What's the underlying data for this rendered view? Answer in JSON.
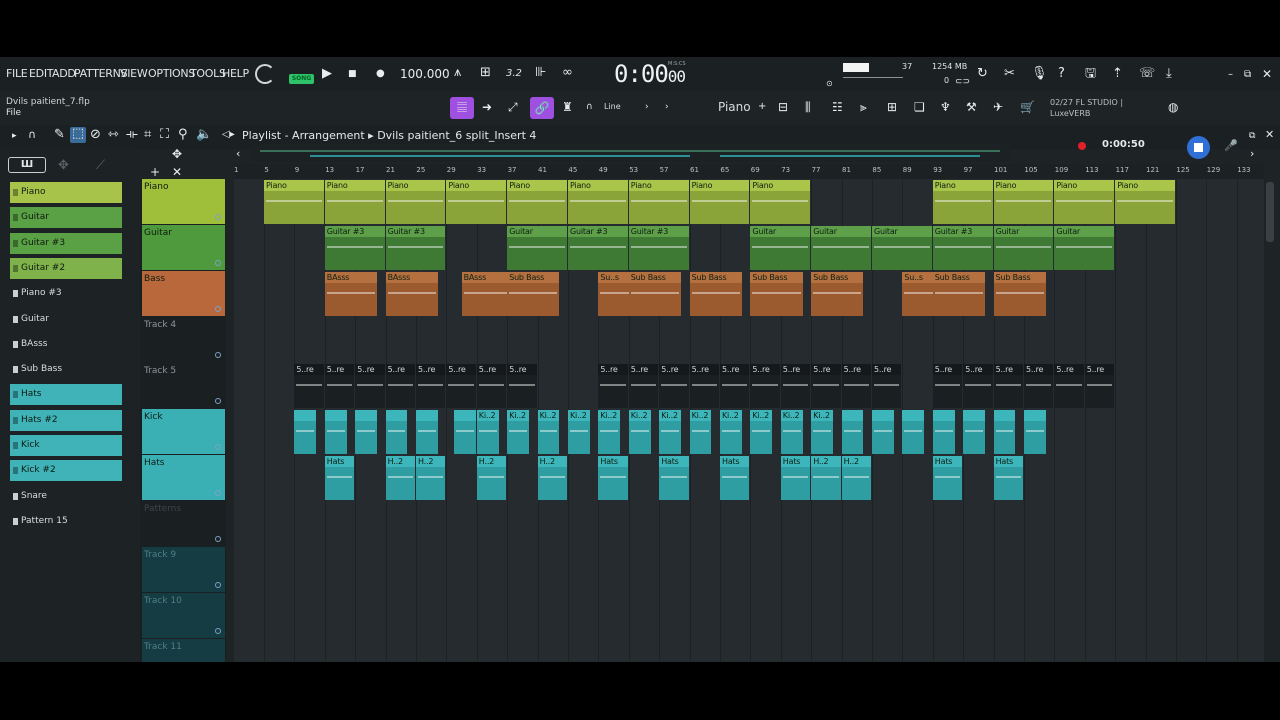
{
  "menu": [
    "FILE",
    "EDIT",
    "ADD",
    "PATTERNS",
    "VIEW",
    "OPTIONS",
    "TOOLS",
    "HELP"
  ],
  "song_mode": "SONG",
  "tempo": "100.000",
  "time_sig": "3.2",
  "clock": "0:00",
  "clock_small": "00",
  "clock_label": "M:S:CS",
  "cpu": "37",
  "memory": "1254 MB",
  "poly": "0",
  "project_file": "Dvils paitient_7.flp",
  "hint": "File",
  "tool_line_label": "Line",
  "piano_label": "Piano",
  "fl_info": {
    "line1": "02/27  FL STUDIO |",
    "line2": "LuxeVERB"
  },
  "playlist_title": "Playlist - Arrangement",
  "playlist_path": "Dvils paitient_6 split_Insert 4",
  "timer": "0:00:50",
  "browser": {
    "toolbar_label": "Ш",
    "patterns": [
      {
        "label": "Piano",
        "color": "#a8c34a"
      },
      {
        "label": "Guitar",
        "color": "#5aa045"
      },
      {
        "label": "Guitar #3",
        "color": "#5aa045"
      },
      {
        "label": "Guitar #2",
        "color": "#7fb24a"
      },
      {
        "label": "Piano #3",
        "color": ""
      },
      {
        "label": "Guitar",
        "color": ""
      },
      {
        "label": "BAsss",
        "color": ""
      },
      {
        "label": "Sub Bass",
        "color": ""
      },
      {
        "label": "Hats",
        "color": "#3fb3b8"
      },
      {
        "label": "Hats #2",
        "color": "#3fb3b8"
      },
      {
        "label": "Kick",
        "color": "#3fb3b8"
      },
      {
        "label": "Kick  #2",
        "color": "#3fb3b8"
      },
      {
        "label": "Snare",
        "color": ""
      },
      {
        "label": "Pattern 15",
        "color": ""
      }
    ]
  },
  "tracks": [
    {
      "name": "Piano",
      "color": "#9fbe3a"
    },
    {
      "name": "Guitar",
      "color": "#4e9a3c"
    },
    {
      "name": "Bass",
      "color": "#b8683a"
    },
    {
      "name": "Track 4",
      "color": ""
    },
    {
      "name": "Track 5",
      "color": ""
    },
    {
      "name": "Kick",
      "color": "#3ab0b4"
    },
    {
      "name": "Hats",
      "color": "#3ab0b4"
    },
    {
      "name": "Patterns",
      "color": ""
    },
    {
      "name": "Track 9",
      "color": "#143c42"
    },
    {
      "name": "Track 10",
      "color": "#143c42"
    },
    {
      "name": "Track 11",
      "color": "#143c42"
    }
  ],
  "ruler": [
    "1",
    "5",
    "9",
    "13",
    "17",
    "21",
    "25",
    "29",
    "33",
    "37",
    "41",
    "45",
    "49",
    "53",
    "57",
    "61",
    "65",
    "69",
    "73",
    "77",
    "81",
    "85",
    "89",
    "93",
    "97",
    "101",
    "105",
    "109",
    "113",
    "117",
    "121",
    "125",
    "129",
    "133"
  ],
  "colors": {
    "piano": "#a9c64b",
    "guitar": "#5ea04a",
    "bass": "#9c5a2f",
    "drums": "#2f9ea3",
    "track5": "#1a1f22"
  },
  "clips": {
    "piano": {
      "label": "Piano",
      "starts": [
        1,
        9,
        17,
        25,
        33,
        41,
        49,
        57,
        65,
        89,
        97,
        105,
        113
      ]
    },
    "guitar": {
      "labels": [
        "Guitar #3",
        "Guitar #3",
        "Guitar",
        "Guitar #3",
        "Guitar #3",
        "Guitar",
        "Guitar",
        "Guitar",
        "Guitar #3",
        "Guitar",
        "Guitar"
      ],
      "starts": [
        9,
        17,
        33,
        41,
        49,
        65,
        73,
        81,
        89,
        97,
        105
      ]
    },
    "bass": {
      "labels": [
        "BAsss",
        "BAsss",
        "BAsss",
        "Sub Bass",
        "Su..s",
        "Sub Bass",
        "Sub Bass",
        "Sub Bass",
        "Sub Bass",
        "Su..s",
        "Sub Bass",
        "Sub Bass"
      ],
      "starts": [
        9,
        17,
        27,
        33,
        45,
        49,
        57,
        65,
        73,
        85,
        89,
        97
      ]
    },
    "track5": {
      "label": "5..re",
      "starts": [
        5,
        9,
        13,
        17,
        21,
        25,
        29,
        33,
        45,
        49,
        53,
        57,
        61,
        65,
        69,
        73,
        77,
        81,
        89,
        93,
        97,
        101,
        105,
        109
      ]
    },
    "kick": {
      "labels": [
        "",
        "",
        "",
        "",
        "",
        "",
        "Ki..2",
        "Ki..2",
        "Ki..2",
        "Ki..2",
        "Ki..2",
        "Ki..2",
        "Ki..2",
        "Ki..2",
        "Ki..2",
        "Ki..2",
        "Ki..2",
        "Ki..2",
        "",
        "",
        "",
        "",
        "",
        ""
      ],
      "starts": [
        5,
        9,
        13,
        17,
        21,
        26,
        29,
        33,
        37,
        41,
        45,
        49,
        53,
        57,
        61,
        65,
        69,
        73,
        77,
        81,
        85,
        89,
        93,
        97,
        101
      ]
    },
    "hats": {
      "labels": [
        "Hats",
        "H..2",
        "H..2",
        "H..2",
        "H..2",
        "Hats",
        "Hats",
        "Hats",
        "Hats",
        "H..2",
        "H..2",
        "Hats",
        "Hats"
      ],
      "starts": [
        9,
        17,
        21,
        29,
        37,
        45,
        53,
        61,
        69,
        73,
        77,
        89,
        97
      ]
    }
  }
}
